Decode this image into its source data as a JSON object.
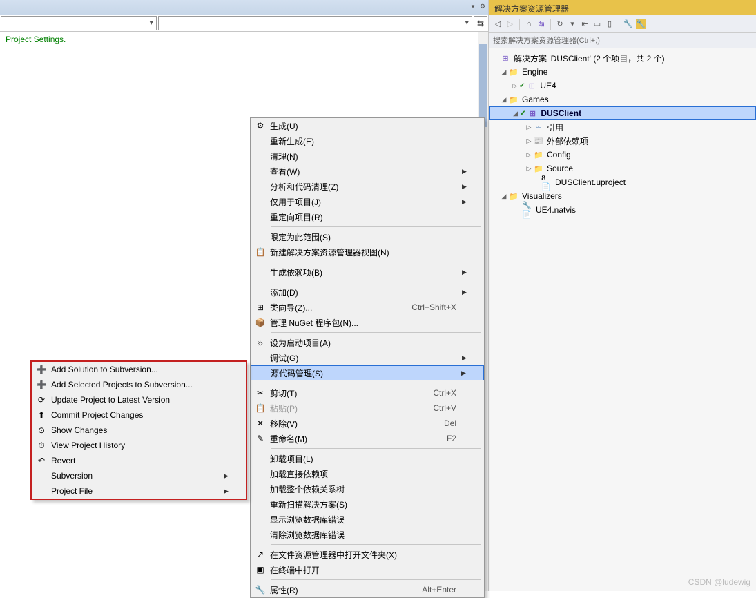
{
  "editor": {
    "content_line": "Project Settings.",
    "toggle_glyph": "⇆"
  },
  "solution_explorer": {
    "title": "解决方案资源管理器",
    "search_placeholder": "搜索解决方案资源管理器(Ctrl+;)",
    "toolbar_icons": [
      "back",
      "forward",
      "home",
      "sync",
      "refresh-group",
      "collapse",
      "doc1",
      "doc2",
      "wrench",
      "spanner"
    ],
    "root": "解决方案 'DUSClient' (2 个项目，共 2 个)",
    "nodes": {
      "engine": "Engine",
      "ue4": "UE4",
      "games": "Games",
      "dusclient": "DUSClient",
      "refs": "引用",
      "external": "外部依赖项",
      "config": "Config",
      "source": "Source",
      "uproject": "DUSClient.uproject",
      "visualizers": "Visualizers",
      "natvis": "UE4.natvis"
    }
  },
  "context_menu": {
    "items": [
      {
        "icon": "⚙",
        "label": "生成(U)"
      },
      {
        "icon": "",
        "label": "重新生成(E)"
      },
      {
        "icon": "",
        "label": "清理(N)"
      },
      {
        "icon": "",
        "label": "查看(W)",
        "submenu": true
      },
      {
        "icon": "",
        "label": "分析和代码清理(Z)",
        "submenu": true
      },
      {
        "icon": "",
        "label": "仅用于项目(J)",
        "submenu": true
      },
      {
        "icon": "",
        "label": "重定向项目(R)"
      },
      {
        "sep": true
      },
      {
        "icon": "",
        "label": "限定为此范围(S)"
      },
      {
        "icon": "📋",
        "label": "新建解决方案资源管理器视图(N)"
      },
      {
        "sep": true
      },
      {
        "icon": "",
        "label": "生成依赖项(B)",
        "submenu": true
      },
      {
        "sep": true
      },
      {
        "icon": "",
        "label": "添加(D)",
        "submenu": true
      },
      {
        "icon": "⊞",
        "label": "类向导(Z)...",
        "shortcut": "Ctrl+Shift+X"
      },
      {
        "icon": "📦",
        "label": "管理 NuGet 程序包(N)..."
      },
      {
        "sep": true
      },
      {
        "icon": "☼",
        "label": "设为启动项目(A)"
      },
      {
        "icon": "",
        "label": "调试(G)",
        "submenu": true
      },
      {
        "icon": "",
        "label": "源代码管理(S)",
        "submenu": true,
        "highlighted": true
      },
      {
        "sep": true
      },
      {
        "icon": "✂",
        "label": "剪切(T)",
        "shortcut": "Ctrl+X"
      },
      {
        "icon": "📋",
        "label": "粘贴(P)",
        "shortcut": "Ctrl+V",
        "disabled": true
      },
      {
        "icon": "✕",
        "label": "移除(V)",
        "shortcut": "Del"
      },
      {
        "icon": "✎",
        "label": "重命名(M)",
        "shortcut": "F2"
      },
      {
        "sep": true
      },
      {
        "icon": "",
        "label": "卸载项目(L)"
      },
      {
        "icon": "",
        "label": "加载直接依赖项"
      },
      {
        "icon": "",
        "label": "加载整个依赖关系树"
      },
      {
        "icon": "",
        "label": "重新扫描解决方案(S)"
      },
      {
        "icon": "",
        "label": "显示浏览数据库错误"
      },
      {
        "icon": "",
        "label": "清除浏览数据库错误"
      },
      {
        "sep": true
      },
      {
        "icon": "↗",
        "label": "在文件资源管理器中打开文件夹(X)"
      },
      {
        "icon": "▣",
        "label": "在终端中打开"
      },
      {
        "sep": true
      },
      {
        "icon": "🔧",
        "label": "属性(R)",
        "shortcut": "Alt+Enter"
      }
    ]
  },
  "svn_submenu": {
    "items": [
      {
        "icon": "➕",
        "label": "Add Solution to Subversion..."
      },
      {
        "icon": "➕",
        "label": "Add Selected Projects to Subversion..."
      },
      {
        "icon": "⟳",
        "label": "Update Project to Latest Version"
      },
      {
        "icon": "⬆",
        "label": "Commit Project Changes"
      },
      {
        "icon": "⊙",
        "label": "Show Changes"
      },
      {
        "icon": "⏱",
        "label": "View Project History"
      },
      {
        "icon": "↶",
        "label": "Revert"
      },
      {
        "icon": "",
        "label": "Subversion",
        "submenu": true
      },
      {
        "icon": "",
        "label": "Project File",
        "submenu": true
      }
    ]
  },
  "watermark": "CSDN @ludewig"
}
